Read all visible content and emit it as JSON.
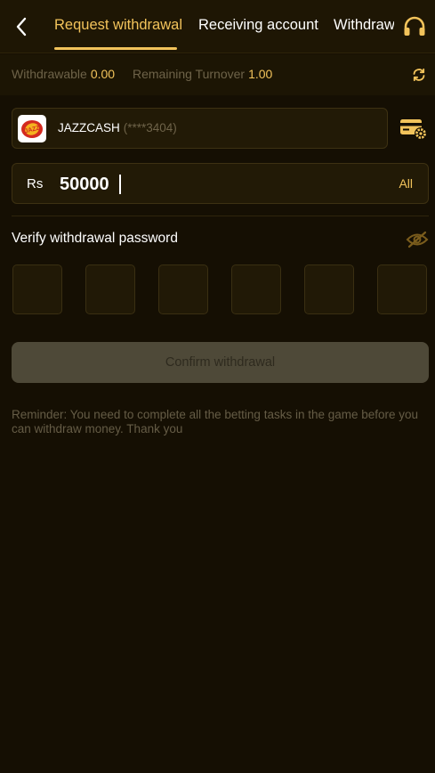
{
  "header": {
    "tabs": [
      {
        "label": "Request withdrawal",
        "active": true
      },
      {
        "label": "Receiving account",
        "active": false
      },
      {
        "label": "Withdraw",
        "active": false
      }
    ],
    "back_icon": "chevron-left-icon",
    "support_icon": "headset-icon"
  },
  "balance": {
    "withdrawable_label": "Withdrawable",
    "withdrawable_value": "0.00",
    "turnover_label": "Remaining Turnover",
    "turnover_value": "1.00",
    "refresh_icon": "refresh-icon"
  },
  "account": {
    "logo_text": "JAZZ",
    "name": "JAZZCASH",
    "masked_number": "(****3404)",
    "manage_icon": "card-settings-icon"
  },
  "amount": {
    "currency": "Rs",
    "value": "50000",
    "all_label": "All"
  },
  "password": {
    "label": "Verify withdrawal password",
    "visibility_icon": "eye-off-icon",
    "digit_count": 6
  },
  "confirm_label": "Confirm withdrawal",
  "reminder": "Reminder: You need to complete all the betting tasks in the game before you can withdraw money. Thank you",
  "colors": {
    "accent": "#f2c35b",
    "background": "#150f03",
    "muted_text": "#6e6349",
    "button_disabled": "#4e4938"
  }
}
